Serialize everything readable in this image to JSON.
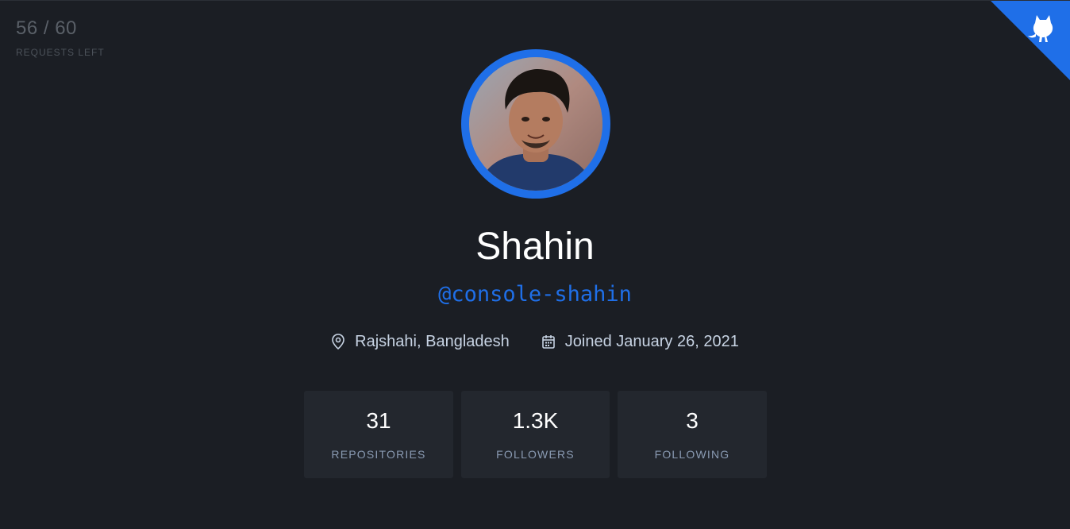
{
  "rate_limit": {
    "count": "56 / 60",
    "label": "REQUESTS LEFT"
  },
  "corner_icon": "octocat-icon",
  "profile": {
    "avatar_alt": "avatar",
    "name": "Shahin",
    "handle": "@console-shahin",
    "location": "Rajshahi, Bangladesh",
    "joined": "Joined January 26, 2021"
  },
  "stats": [
    {
      "value": "31",
      "label": "REPOSITORIES"
    },
    {
      "value": "1.3K",
      "label": "FOLLOWERS"
    },
    {
      "value": "3",
      "label": "FOLLOWING"
    }
  ],
  "colors": {
    "background": "#1b1e24",
    "accent": "#1f6fe8",
    "card": "#23272e"
  }
}
